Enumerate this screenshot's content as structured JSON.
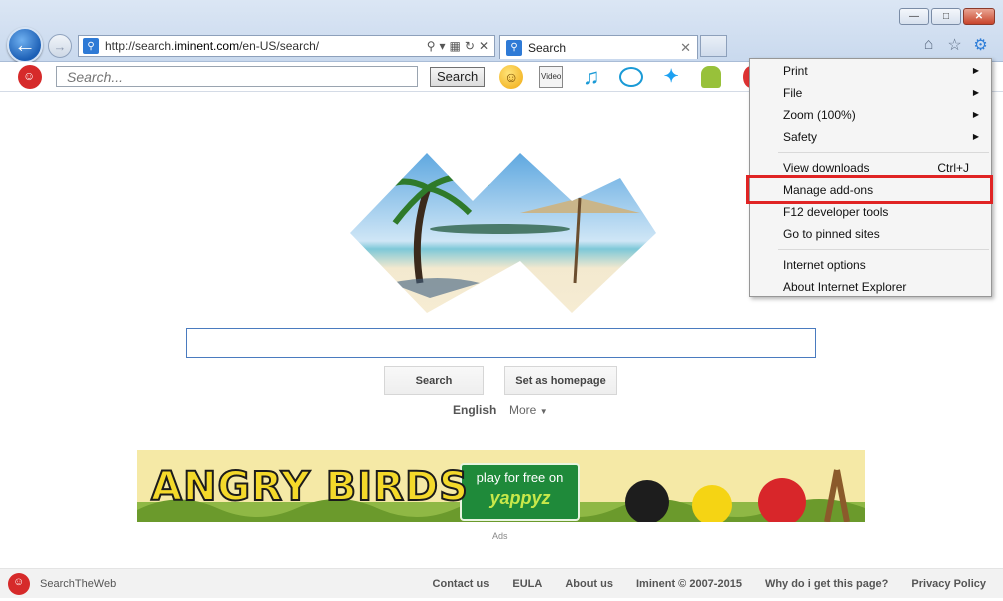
{
  "window": {
    "minimize_icon": "minimize-icon",
    "maximize_icon": "maximize-icon",
    "close_icon": "close-icon"
  },
  "navigation": {
    "url_prefix": "http://search.",
    "url_domain": "iminent.com",
    "url_suffix": "/en-US/search/",
    "tab_title": "Search"
  },
  "toolbar": {
    "search_placeholder": "Search...",
    "search_button": "Search",
    "video_label": "Video"
  },
  "page": {
    "search_button": "Search",
    "homepage_button": "Set as homepage",
    "language": "English",
    "more_label": "More",
    "banner_title": "ANGRY BIRDS",
    "banner_cta_line1": "play for free on",
    "banner_cta_line2": "yappyz",
    "ads_label": "Ads"
  },
  "footer": {
    "brand": "SearchTheWeb",
    "links": [
      "Contact us",
      "EULA",
      "About us",
      "Iminent © 2007-2015",
      "Why do i get this page?",
      "Privacy Policy"
    ]
  },
  "menu": {
    "items": [
      {
        "label": "Print",
        "submenu": true
      },
      {
        "label": "File",
        "submenu": true
      },
      {
        "label": "Zoom (100%)",
        "submenu": true
      },
      {
        "label": "Safety",
        "submenu": true
      },
      {
        "label": "View downloads",
        "shortcut": "Ctrl+J"
      },
      {
        "label": "Manage add-ons",
        "highlighted": true
      },
      {
        "label": "F12 developer tools"
      },
      {
        "label": "Go to pinned sites"
      },
      {
        "label": "Internet options"
      },
      {
        "label": "About Internet Explorer"
      }
    ]
  },
  "colors": {
    "highlight_border": "#e02424",
    "link_blue": "#2f7ed8"
  }
}
